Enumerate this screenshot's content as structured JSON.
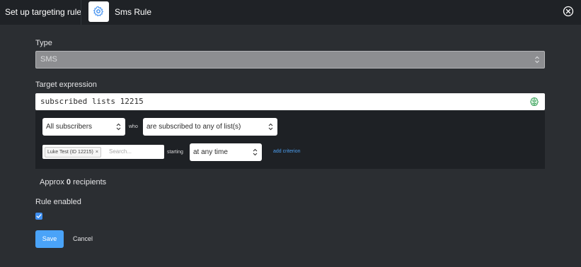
{
  "header": {
    "title": "Set up targeting rule",
    "rule_icon": "gear-icon",
    "rule_name": "Sms Rule",
    "close_icon": "close-circle-icon"
  },
  "form": {
    "type_label": "Type",
    "type_value": "SMS",
    "target_label": "Target expression",
    "target_value": "subscribed lists 12215",
    "target_icon": "brain-icon",
    "builder": {
      "subscribers_select": "All subscribers",
      "who_text": "who",
      "condition_select": "are subscribed to any of list(s)",
      "list_tag": "Luke Test (ID 12215)",
      "tag_remove": "×",
      "search_placeholder": "Search...",
      "starting_text": "starting",
      "time_select": "at any time",
      "add_criterion": "add criterion"
    },
    "approx_prefix": "Approx",
    "approx_count": "0",
    "approx_suffix": "recipients",
    "rule_enabled_label": "Rule enabled",
    "rule_enabled": true,
    "save_label": "Save",
    "cancel_label": "Cancel"
  },
  "colors": {
    "accent": "#4aa3f8",
    "header_bg": "#1f2226",
    "page_bg": "#2b2e32",
    "panel_bg": "#1e2125",
    "link": "#4c9ff1"
  }
}
